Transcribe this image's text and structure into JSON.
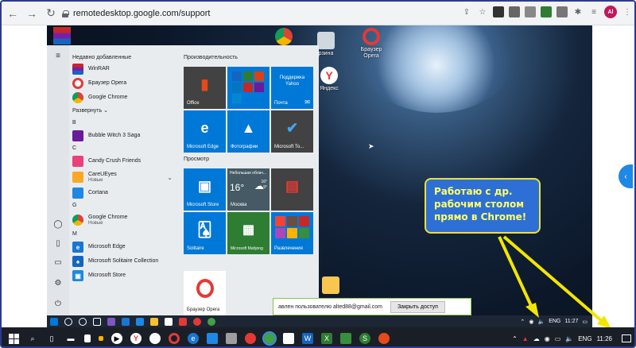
{
  "browser": {
    "url": "remotedesktop.google.com/support",
    "avatar_initials": "Al"
  },
  "desktop": {
    "icons": [
      {
        "label": ""
      },
      {
        "label": "рзина"
      },
      {
        "label": "Браузер Opera"
      },
      {
        "label": "Яндекс"
      }
    ]
  },
  "start_menu": {
    "recent_header": "Недавно добавленные",
    "recent": [
      {
        "name": "WinRAR",
        "color": "#7b1fa2"
      },
      {
        "name": "Браузер Opera",
        "color": "#e53935"
      },
      {
        "name": "Google Chrome",
        "color": "#43a047"
      }
    ],
    "expand_label": "Развернуть",
    "groups": [
      {
        "letter": "B",
        "apps": [
          {
            "name": "Bubble Witch 3 Saga",
            "sub": "",
            "color": "#6a1b9a"
          }
        ]
      },
      {
        "letter": "C",
        "apps": [
          {
            "name": "Candy Crush Friends",
            "sub": "",
            "color": "#ec407a"
          },
          {
            "name": "CareUEyes",
            "sub": "Новые",
            "color": "#f9a825"
          },
          {
            "name": "Cortana",
            "sub": "",
            "color": "#1e88e5"
          }
        ]
      },
      {
        "letter": "G",
        "apps": [
          {
            "name": "Google Chrome",
            "sub": "Новые",
            "color": "#43a047"
          }
        ]
      },
      {
        "letter": "M",
        "apps": [
          {
            "name": "Microsoft Edge",
            "sub": "",
            "color": "#1976d2"
          },
          {
            "name": "Microsoft Solitaire Collection",
            "sub": "",
            "color": "#1565c0"
          },
          {
            "name": "Microsoft Store",
            "sub": "",
            "color": "#1e88e5"
          }
        ]
      }
    ],
    "tiles_header_1": "Производительность",
    "tiles_header_2": "Просмотр",
    "tiles": {
      "office": "Office",
      "yahoo_line1": "Поддержка",
      "yahoo_line2": "Yahoo",
      "mail": "Почта",
      "edge": "Microsoft Edge",
      "photos": "Фотографии",
      "todo": "Microsoft To...",
      "store": "Microsoft Store",
      "weather_top": "Небольшая облач...",
      "weather_temp": "16°",
      "weather_hi": "16°",
      "weather_lo": "9°",
      "weather_city": "Москва",
      "solitaire": "Solitaire",
      "mahjong": "Microsoft Mahjong",
      "fun": "Развлечения",
      "opera": "Браузер Opera"
    }
  },
  "notice": {
    "text": "авлен пользователю alted88@gmail.com",
    "button": "Закрыть доступ"
  },
  "remote_tray": {
    "lang": "ENG",
    "time": "11:27"
  },
  "host_tray": {
    "lang": "ENG",
    "time": "11:26"
  },
  "callout": {
    "line1": "Работаю с др.",
    "line2": "рабочим столом",
    "line3": "прямо в Chrome!"
  },
  "colors": {
    "accent": "#0078d7",
    "callout_bg": "#2e6fd6",
    "callout_text": "#ffff66",
    "arrow": "#f2e600"
  }
}
